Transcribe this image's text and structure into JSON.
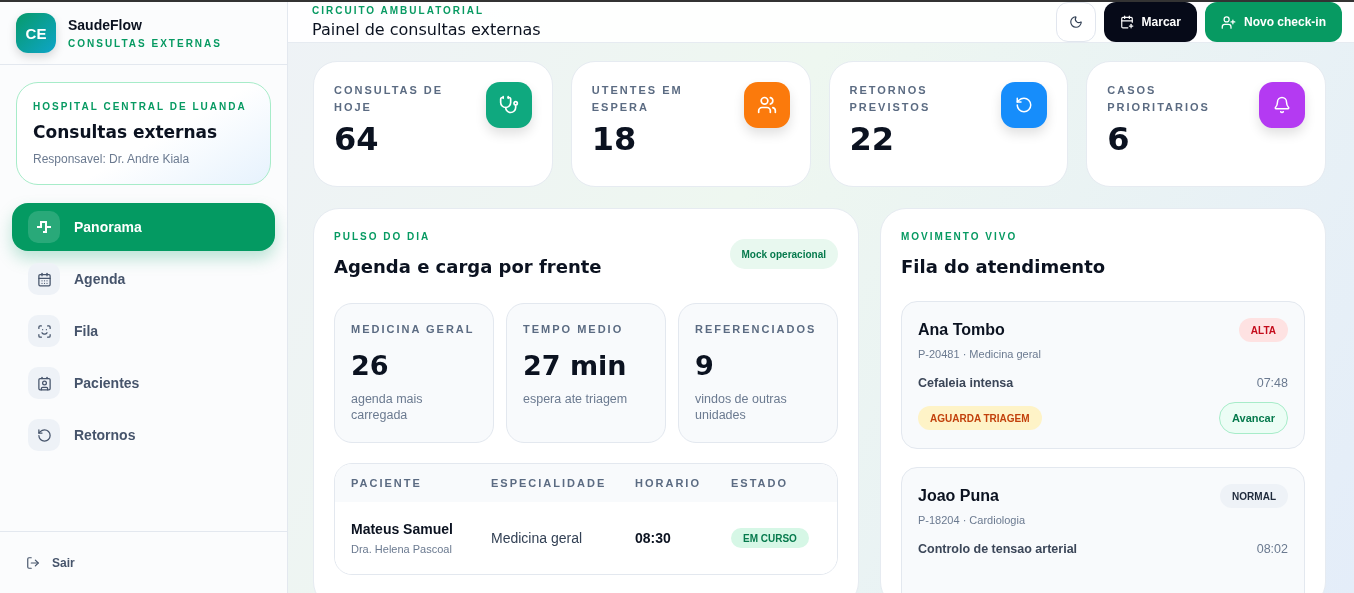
{
  "brand": {
    "initials": "CE",
    "name": "SaudeFlow",
    "subtitle": "CONSULTAS EXTERNAS"
  },
  "unit_card": {
    "eyebrow": "HOSPITAL CENTRAL DE LUANDA",
    "title": "Consultas externas",
    "responsible": "Responsavel: Dr. Andre Kiala"
  },
  "nav": [
    {
      "label": "Panorama",
      "selected": true
    },
    {
      "label": "Agenda",
      "selected": false
    },
    {
      "label": "Fila",
      "selected": false
    },
    {
      "label": "Pacientes",
      "selected": false
    },
    {
      "label": "Retornos",
      "selected": false
    }
  ],
  "logout": "Sair",
  "header": {
    "eyebrow": "CIRCUITO AMBULATORIAL",
    "title": "Painel de consultas externas",
    "buttons": [
      {
        "label": "Marcar",
        "kind": "dark"
      },
      {
        "label": "Novo check-in",
        "kind": "primary"
      }
    ]
  },
  "stats": [
    {
      "label": "CONSULTAS DE HOJE",
      "value": "64",
      "color": "#0fa97f"
    },
    {
      "label": "UTENTES EM ESPERA",
      "value": "18",
      "color": "#fb7a0c"
    },
    {
      "label": "RETORNOS PREVISTOS",
      "value": "22",
      "color": "#168dfb"
    },
    {
      "label": "CASOS PRIORITARIOS",
      "value": "6",
      "color": "#b43af2"
    }
  ],
  "pulse": {
    "eyebrow": "PULSO DO DIA",
    "title": "Agenda e carga por frente",
    "badge": "Mock operacional",
    "metrics": [
      {
        "label": "MEDICINA GERAL",
        "value": "26",
        "note": "agenda mais carregada"
      },
      {
        "label": "TEMPO MEDIO",
        "value": "27 min",
        "note": "espera ate triagem"
      },
      {
        "label": "REFERENCIADOS",
        "value": "9",
        "note": "vindos de outras unidades"
      }
    ],
    "table": {
      "columns": [
        "PACIENTE",
        "ESPECIALIDADE",
        "HORARIO",
        "ESTADO"
      ],
      "rows": [
        {
          "patient": "Mateus Samuel",
          "doctor": "Dra. Helena Pascoal",
          "specialty": "Medicina geral",
          "time": "08:30",
          "status": "EM CURSO"
        }
      ]
    }
  },
  "queue": {
    "eyebrow": "MOVIMENTO VIVO",
    "title": "Fila do atendimento",
    "items": [
      {
        "name": "Ana Tombo",
        "priority": "ALTA",
        "kind": "high",
        "meta": "P-20481 · Medicina geral",
        "reason": "Cefaleia intensa",
        "time": "07:48",
        "status": "AGUARDA TRIAGEM",
        "action": "Avancar"
      },
      {
        "name": "Joao Puna",
        "priority": "NORMAL",
        "kind": "normal",
        "meta": "P-18204 · Cardiologia",
        "reason": "Controlo de tensao arterial",
        "time": "08:02"
      }
    ]
  }
}
